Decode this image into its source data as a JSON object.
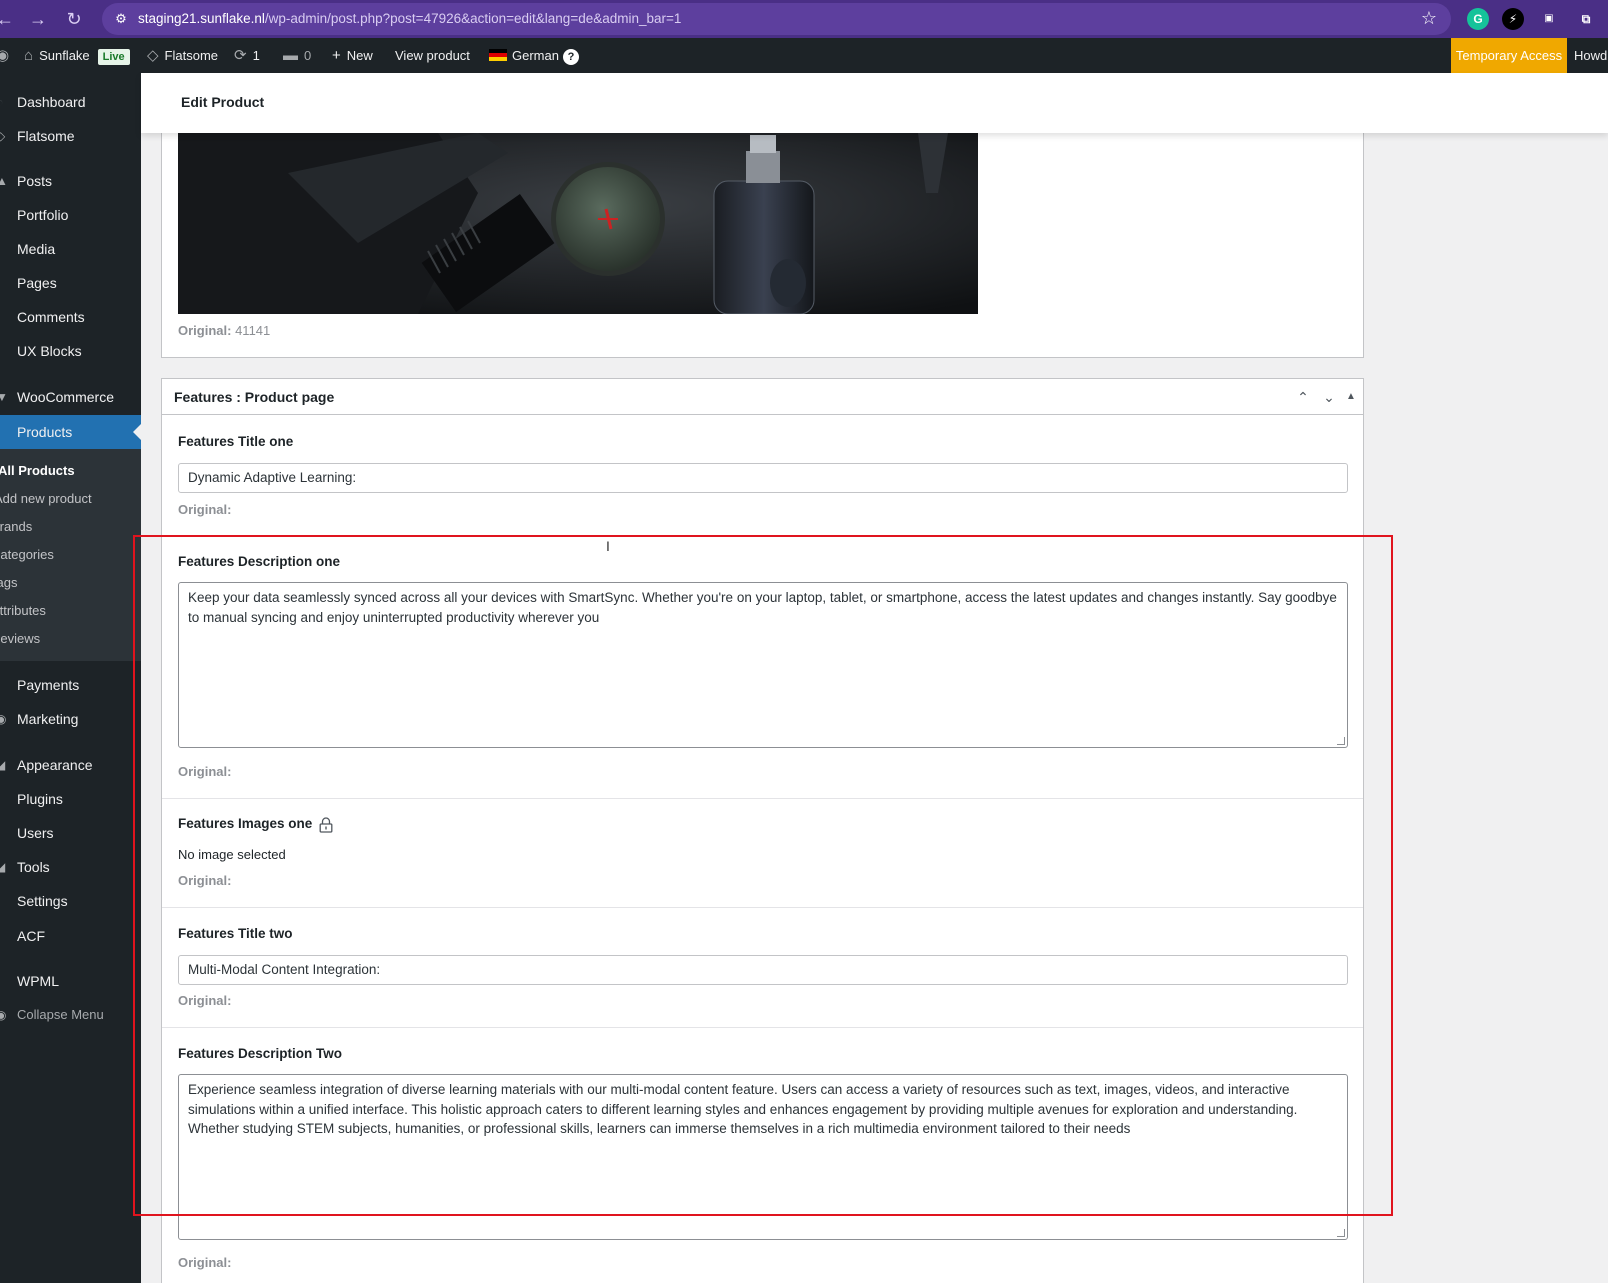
{
  "browser": {
    "url_host": "staging21.sunflake.nl",
    "url_path": "/wp-admin/post.php?post=47926&action=edit&lang=de&admin_bar=1"
  },
  "adminbar": {
    "site_name": "Sunflake",
    "live_badge": "Live",
    "theme": "Flatsome",
    "updates_count": "1",
    "comments_count": "0",
    "new_label": "New",
    "view_product": "View product",
    "language": "German",
    "help": "?",
    "temporary_access": "Temporary Access",
    "howdy": "Howd"
  },
  "sidebar": {
    "items": [
      {
        "label": "Dashboard"
      },
      {
        "label": "Flatsome"
      },
      {
        "label": "Posts"
      },
      {
        "label": "Portfolio"
      },
      {
        "label": "Media"
      },
      {
        "label": "Pages"
      },
      {
        "label": "Comments"
      },
      {
        "label": "UX Blocks"
      },
      {
        "label": "WooCommerce"
      },
      {
        "label": "Products"
      },
      {
        "label": "Payments"
      },
      {
        "label": "Marketing"
      },
      {
        "label": "Appearance"
      },
      {
        "label": "Plugins"
      },
      {
        "label": "Users"
      },
      {
        "label": "Tools"
      },
      {
        "label": "Settings"
      },
      {
        "label": "ACF"
      },
      {
        "label": "WPML"
      }
    ],
    "submenu": [
      {
        "label": "All Products"
      },
      {
        "label": "Add new product"
      },
      {
        "label": "Brands"
      },
      {
        "label": "Categories"
      },
      {
        "label": "Tags"
      },
      {
        "label": "Attributes"
      },
      {
        "label": "Reviews"
      }
    ],
    "collapse": "Collapse Menu"
  },
  "header": {
    "title": "Edit Product"
  },
  "image_panel": {
    "original_label": "Original:",
    "original_value": "41141"
  },
  "features_panel": {
    "title": "Features : Product page",
    "fields": {
      "title_one": {
        "label": "Features Title one",
        "value": "Dynamic Adaptive Learning:",
        "original": "Original:"
      },
      "desc_one": {
        "label": "Features Description one",
        "value": "Keep your data seamlessly synced across all your devices with SmartSync. Whether you're on your laptop, tablet, or smartphone, access the latest updates and changes instantly. Say goodbye to manual syncing and enjoy uninterrupted productivity wherever you",
        "original": "Original:"
      },
      "images_one": {
        "label": "Features Images one",
        "value": "No image selected",
        "original": "Original:"
      },
      "title_two": {
        "label": "Features Title two",
        "value": "Multi-Modal Content Integration:",
        "original": "Original:"
      },
      "desc_two": {
        "label": "Features Description Two",
        "value": "Experience seamless integration of diverse learning materials with our multi-modal content feature. Users can access a variety of resources such as text, images, videos, and interactive simulations within a unified interface. This holistic approach caters to different learning styles and enhances engagement by providing multiple avenues for exploration and understanding. Whether studying STEM subjects, humanities, or professional skills, learners can immerse themselves in a rich multimedia environment tailored to their needs",
        "original": "Original:"
      }
    }
  },
  "colors": {
    "admin_bar": "#1d2327",
    "active_menu": "#2271b1",
    "temporary_access": "#f0a800",
    "highlight_box": "#e0141e",
    "browser_frame": "#4a2f86"
  }
}
